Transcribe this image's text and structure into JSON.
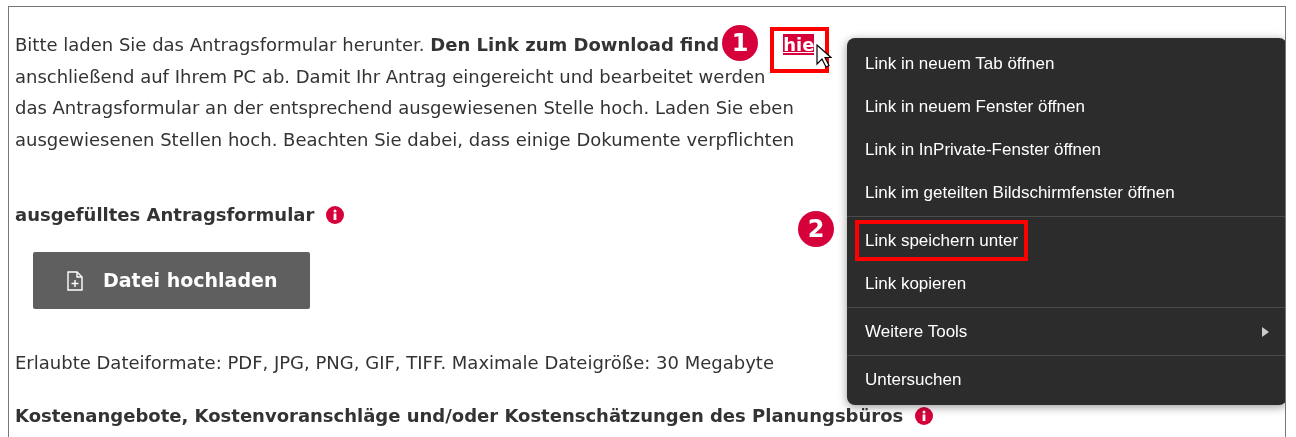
{
  "paragraph": {
    "lines": [
      {
        "parts": [
          {
            "kind": "text",
            "text": "Bitte laden Sie das Antragsformular herunter. **Den Link zum Download find**"
          },
          {
            "kind": "link",
            "text": "hie",
            "highlighted": true
          }
        ]
      },
      {
        "parts": [
          {
            "kind": "text",
            "text": "anschließend auf Ihrem PC ab. Damit Ihr Antrag eingereicht und bearbeitet werden"
          }
        ]
      },
      {
        "parts": [
          {
            "kind": "text",
            "text": "das Antragsformular an der entsprechend ausgewiesenen Stelle hoch. Laden Sie eben"
          }
        ]
      },
      {
        "parts": [
          {
            "kind": "text",
            "text": "ausgewiesenen Stellen hoch. Beachten Sie dabei, dass einige Dokumente verpflichten"
          }
        ]
      }
    ]
  },
  "upload_section": {
    "heading": "ausgefülltes Antragsformular",
    "button": "Datei hochladen",
    "hint": "Erlaubte Dateiformate: PDF, JPG, PNG, GIF, TIFF. Maximale Dateigröße: 30 Megabyte"
  },
  "next_heading": "Kostenangebote, Kostenvoranschläge und/oder Kostenschätzungen des Planungsbüros",
  "context_menu": {
    "groups": [
      [
        {
          "kind": "item",
          "label": "Link in neuem Tab öffnen",
          "highlighted": false
        },
        {
          "kind": "item",
          "label": "Link in neuem Fenster öffnen",
          "highlighted": false
        },
        {
          "kind": "item",
          "label": "Link in InPrivate-Fenster öffnen",
          "highlighted": false
        },
        {
          "kind": "item",
          "label": "Link im geteilten Bildschirmfenster öffnen",
          "highlighted": false
        }
      ],
      [
        {
          "kind": "item",
          "label": "Link speichern unter",
          "highlighted": true
        },
        {
          "kind": "item",
          "label": "Link kopieren",
          "highlighted": false
        }
      ],
      [
        {
          "kind": "submenu",
          "label": "Weitere Tools",
          "highlighted": false
        }
      ],
      [
        {
          "kind": "item",
          "label": "Untersuchen",
          "highlighted": false
        }
      ]
    ]
  },
  "callouts": [
    "1",
    "2"
  ]
}
